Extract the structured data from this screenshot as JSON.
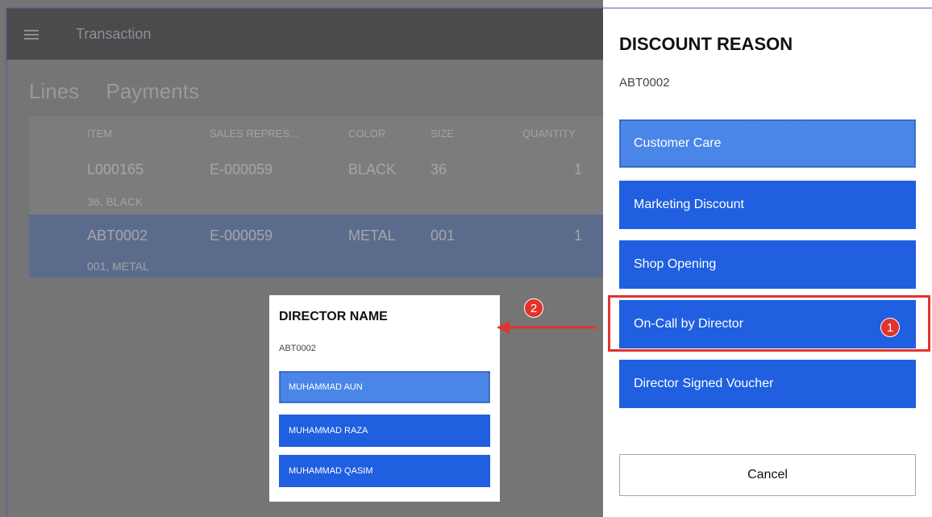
{
  "header": {
    "title": "Transaction"
  },
  "tabs": [
    "Lines",
    "Payments"
  ],
  "grid": {
    "columns": [
      "ITEM",
      "SALES REPRES...",
      "COLOR",
      "SIZE",
      "QUANTITY"
    ],
    "rows": [
      {
        "item": "L000165",
        "sales_rep": "E-000059",
        "color": "BLACK",
        "size": "36",
        "quantity": "1",
        "detail": "36, BLACK"
      },
      {
        "item": "ABT0002",
        "sales_rep": "E-000059",
        "color": "METAL",
        "size": "001",
        "quantity": "1",
        "detail": "001, METAL"
      }
    ]
  },
  "director_dialog": {
    "title": "DIRECTOR NAME",
    "item": "ABT0002",
    "options": [
      "MUHAMMAD AUN",
      "MUHAMMAD RAZA",
      "MUHAMMAD QASIM"
    ]
  },
  "discount_panel": {
    "title": "DISCOUNT REASON",
    "item": "ABT0002",
    "options": [
      "Customer Care",
      "Marketing Discount",
      "Shop Opening",
      "On-Call by Director",
      "Director Signed Voucher"
    ],
    "cancel_label": "Cancel"
  },
  "annotations": {
    "badge1": "1",
    "badge2": "2"
  },
  "colors": {
    "accent": "#1f5fe0",
    "highlight": "#4a86e8",
    "annotation": "#e03434"
  }
}
